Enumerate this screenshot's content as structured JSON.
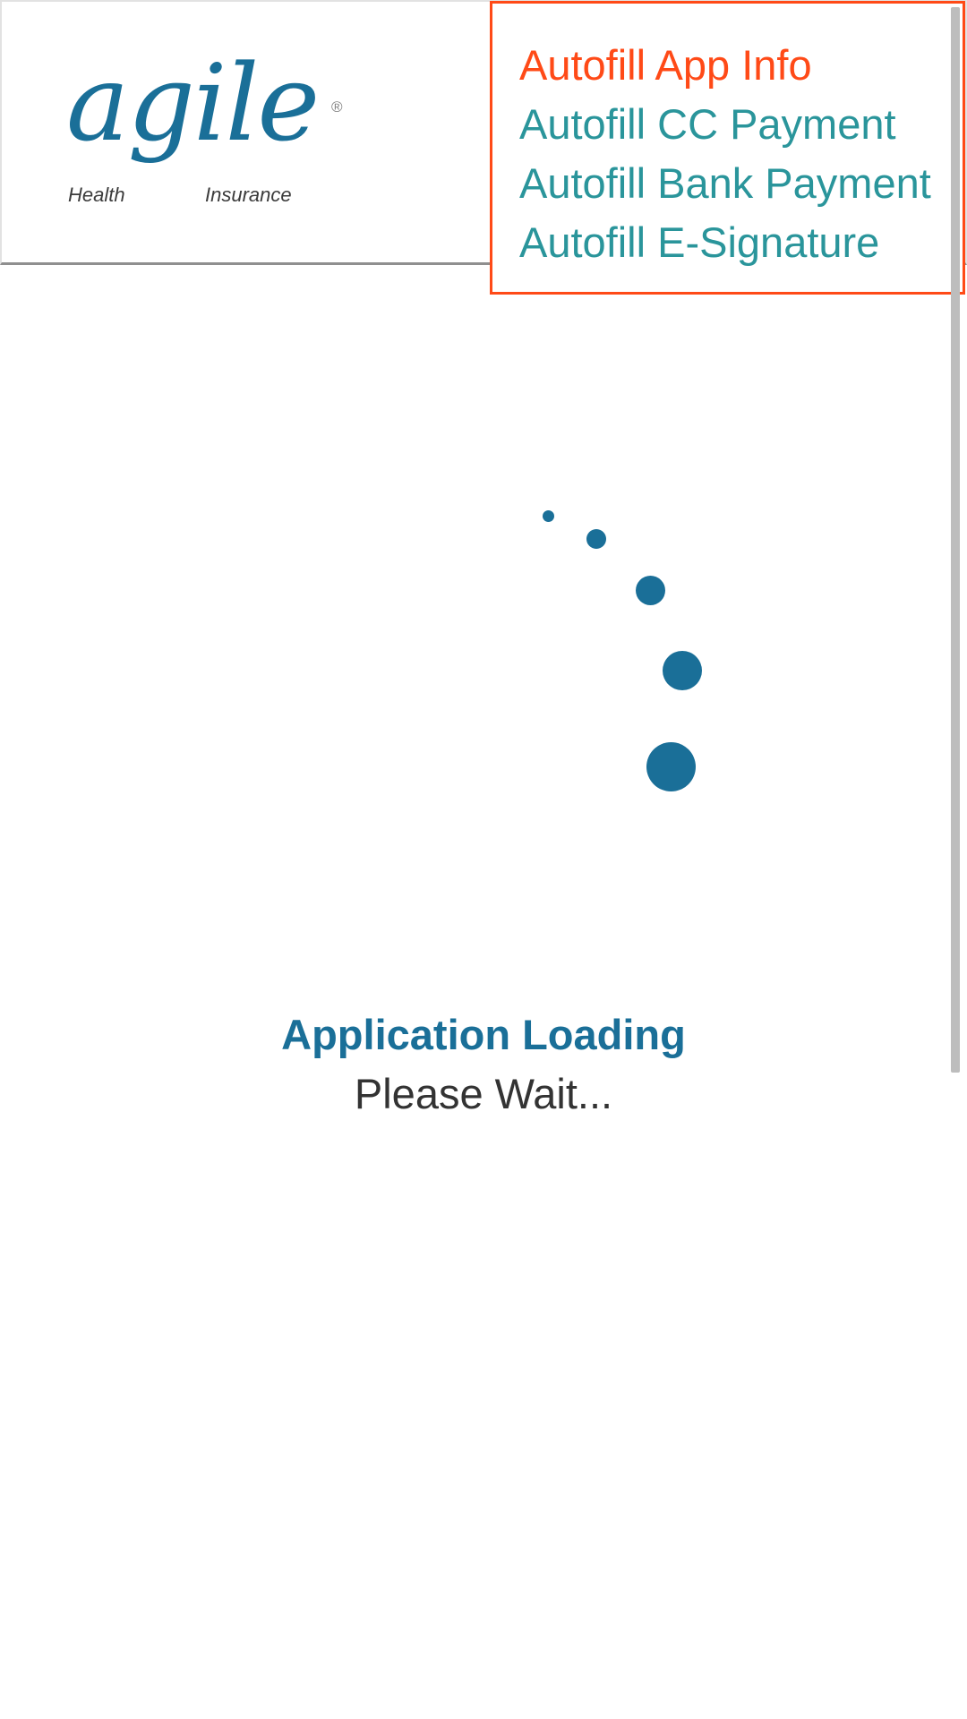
{
  "logo": {
    "wordmark": "agile",
    "registered_mark": "®",
    "subtitle_left": "Health",
    "subtitle_right": "Insurance"
  },
  "autofill_menu": {
    "items": [
      {
        "label": "Autofill App Info",
        "active": true
      },
      {
        "label": "Autofill CC Payment",
        "active": false
      },
      {
        "label": "Autofill Bank Payment",
        "active": false
      },
      {
        "label": "Autofill E-Signature",
        "active": false
      }
    ],
    "border_color": "#ff4a17",
    "active_color": "#ff4a17",
    "item_color": "#2a959b"
  },
  "loading": {
    "title": "Application Loading",
    "subtitle": "Please Wait...",
    "spinner_icon": "loading-spinner-icon",
    "accent_color": "#1a6f98"
  }
}
